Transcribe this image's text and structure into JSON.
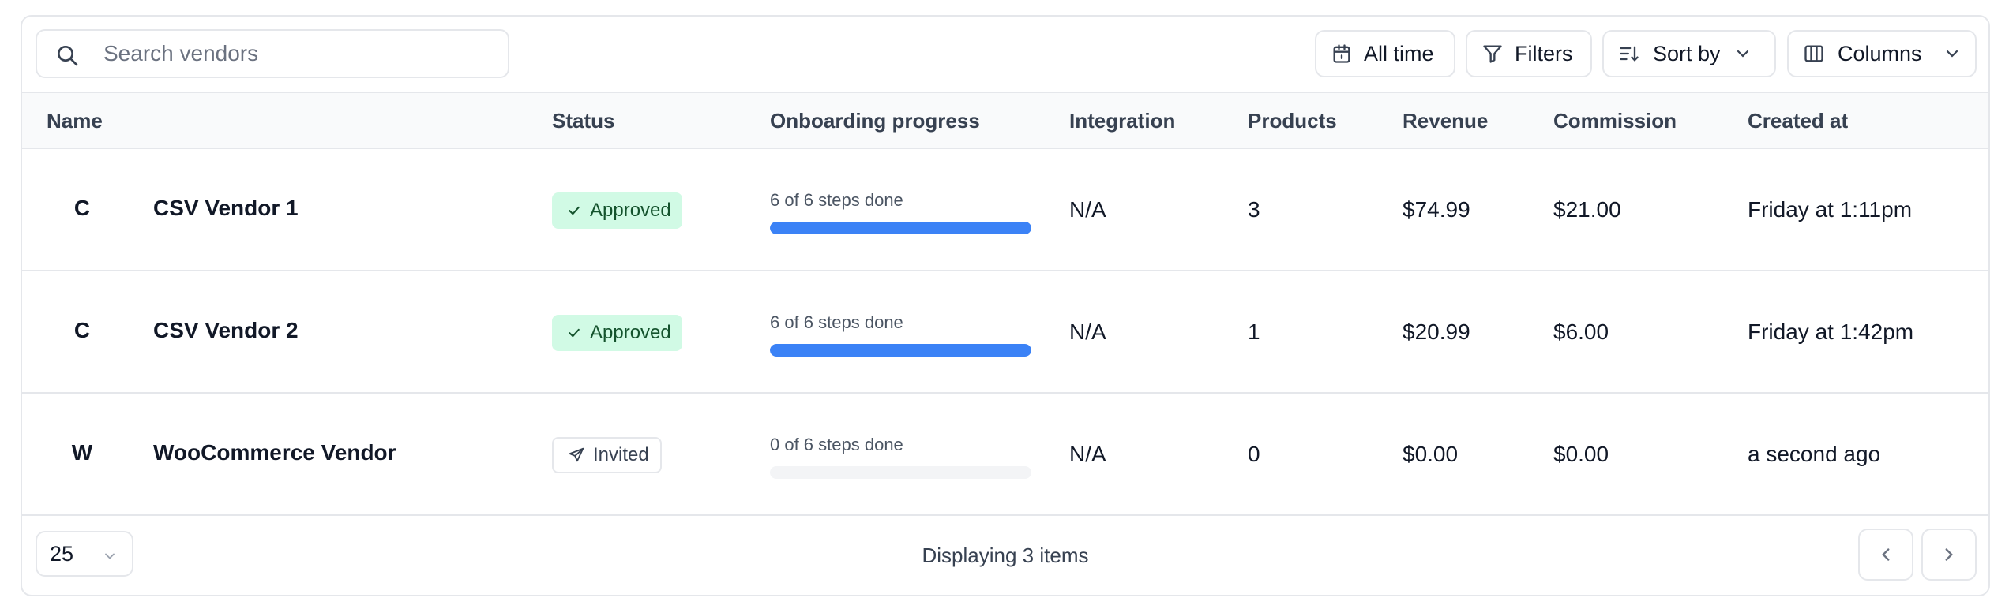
{
  "search": {
    "placeholder": "Search vendors",
    "value": ""
  },
  "toolbar": {
    "date_label": "All time",
    "filters_label": "Filters",
    "sort_label": "Sort by",
    "columns_label": "Columns"
  },
  "table": {
    "headers": {
      "name": "Name",
      "status": "Status",
      "onboarding": "Onboarding progress",
      "integration": "Integration",
      "products": "Products",
      "revenue": "Revenue",
      "commission": "Commission",
      "created_at": "Created at"
    },
    "rows": [
      {
        "initial": "C",
        "name": "CSV Vendor 1",
        "status": "Approved",
        "progress_label": "6 of 6 steps done",
        "progress": 1.0,
        "integration": "N/A",
        "products": "3",
        "revenue": "$74.99",
        "commission": "$21.00",
        "created_at": "Friday at 1:11pm"
      },
      {
        "initial": "C",
        "name": "CSV Vendor 2",
        "status": "Approved",
        "progress_label": "6 of 6 steps done",
        "progress": 1.0,
        "integration": "N/A",
        "products": "1",
        "revenue": "$20.99",
        "commission": "$6.00",
        "created_at": "Friday at 1:42pm"
      },
      {
        "initial": "W",
        "name": "WooCommerce Vendor",
        "status": "Invited",
        "progress_label": "0 of 6 steps done",
        "progress": 0.0,
        "integration": "N/A",
        "products": "0",
        "revenue": "$0.00",
        "commission": "$0.00",
        "created_at": "a second ago"
      }
    ]
  },
  "footer": {
    "page_size": "25",
    "display_text": "Displaying 3 items"
  },
  "colors": {
    "progress_fill": "#3b82f6",
    "approved_bg": "#d1fae5",
    "border": "#e5e7eb"
  }
}
